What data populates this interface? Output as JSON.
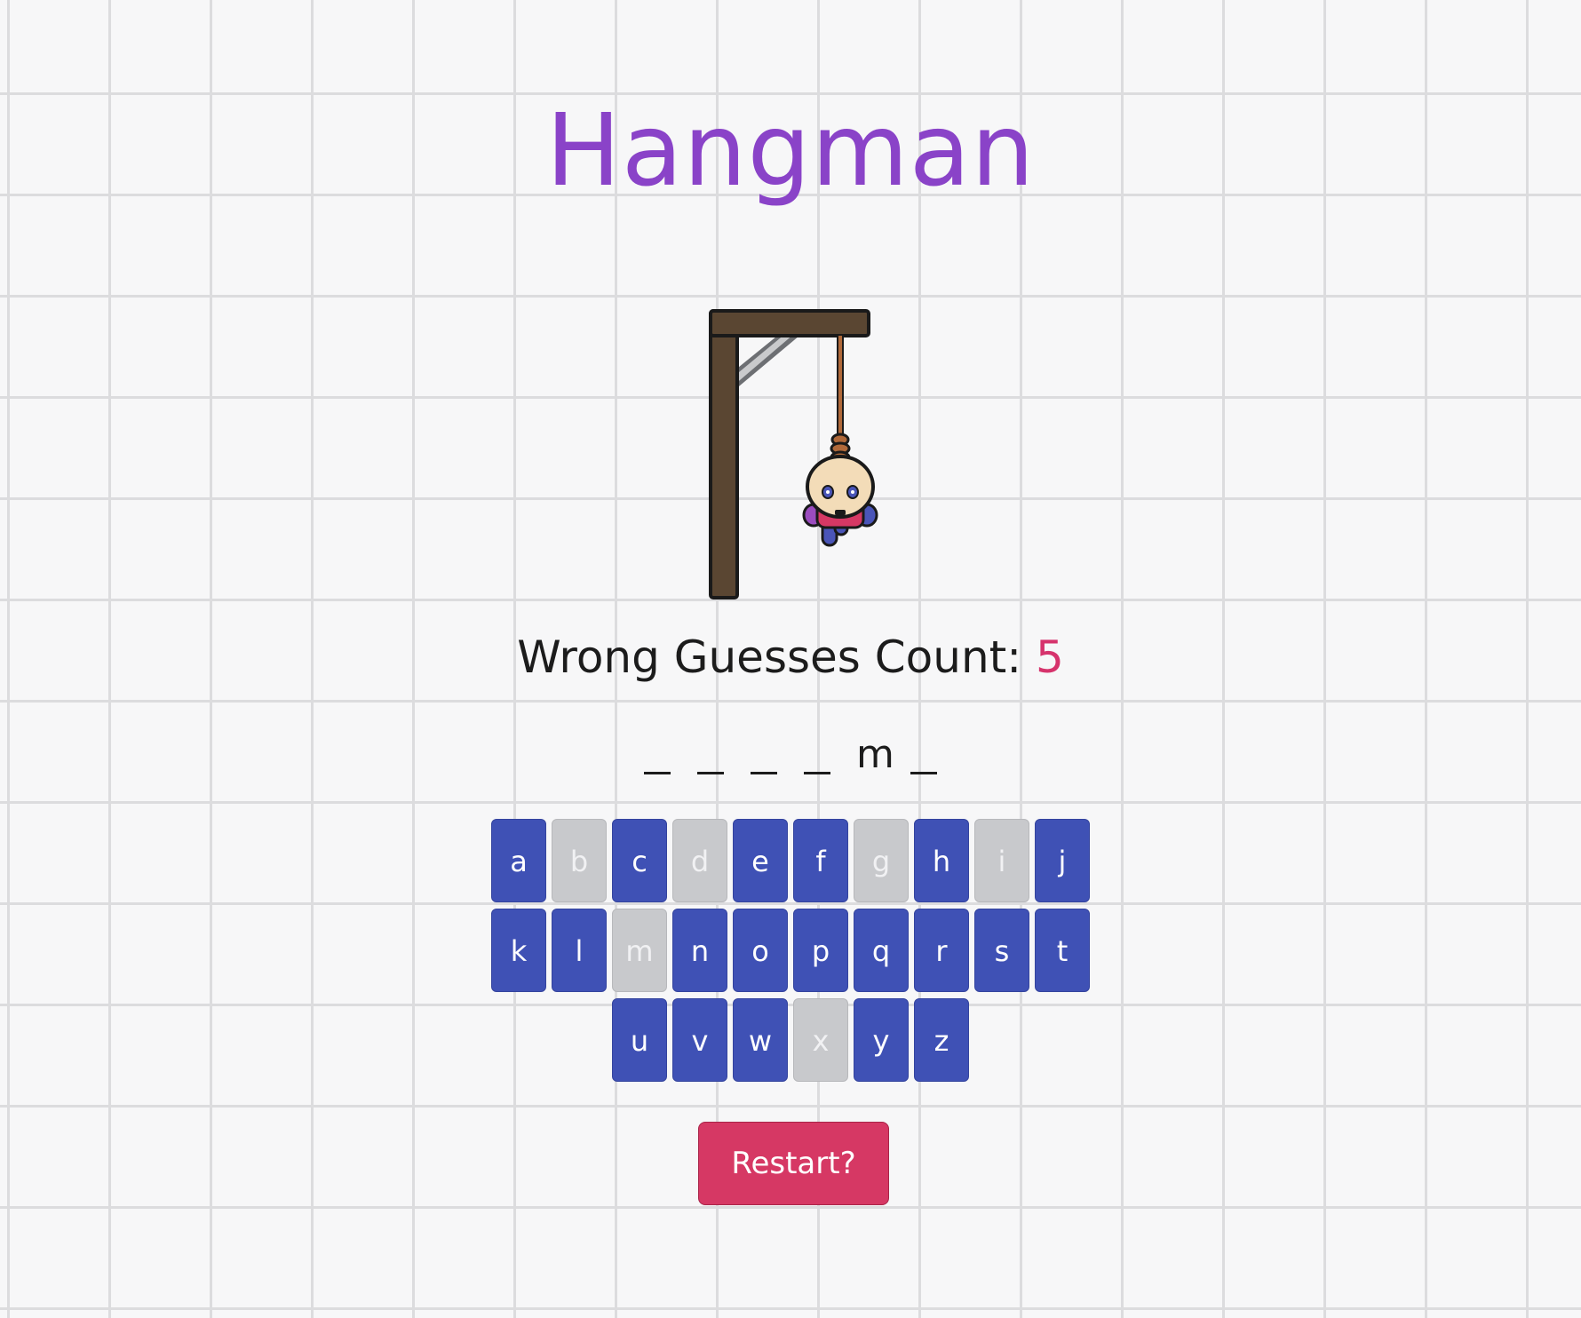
{
  "header": {
    "title": "Hangman"
  },
  "status": {
    "wrong_label": "Wrong Guesses Count:",
    "wrong_count": "5"
  },
  "word": {
    "slots": [
      "",
      "",
      "",
      "",
      "m",
      ""
    ]
  },
  "keyboard": {
    "rows": [
      [
        {
          "letter": "a",
          "used": false
        },
        {
          "letter": "b",
          "used": true
        },
        {
          "letter": "c",
          "used": false
        },
        {
          "letter": "d",
          "used": true
        },
        {
          "letter": "e",
          "used": false
        },
        {
          "letter": "f",
          "used": false
        },
        {
          "letter": "g",
          "used": true
        },
        {
          "letter": "h",
          "used": false
        },
        {
          "letter": "i",
          "used": true
        },
        {
          "letter": "j",
          "used": false
        }
      ],
      [
        {
          "letter": "k",
          "used": false
        },
        {
          "letter": "l",
          "used": false
        },
        {
          "letter": "m",
          "used": true
        },
        {
          "letter": "n",
          "used": false
        },
        {
          "letter": "o",
          "used": false
        },
        {
          "letter": "p",
          "used": false
        },
        {
          "letter": "q",
          "used": false
        },
        {
          "letter": "r",
          "used": false
        },
        {
          "letter": "s",
          "used": false
        },
        {
          "letter": "t",
          "used": false
        }
      ],
      [
        {
          "letter": "u",
          "used": false
        },
        {
          "letter": "v",
          "used": false
        },
        {
          "letter": "w",
          "used": false
        },
        {
          "letter": "x",
          "used": true
        },
        {
          "letter": "y",
          "used": false
        },
        {
          "letter": "z",
          "used": false
        }
      ]
    ]
  },
  "actions": {
    "restart_label": "Restart?"
  },
  "colors": {
    "title": "#8a43c8",
    "key_active": "#3f51b5",
    "key_used": "#c8c9cc",
    "wrong_count": "#d6336c",
    "restart": "#d63864"
  },
  "illustration": {
    "name": "gallows-with-hanging-figure-icon"
  }
}
